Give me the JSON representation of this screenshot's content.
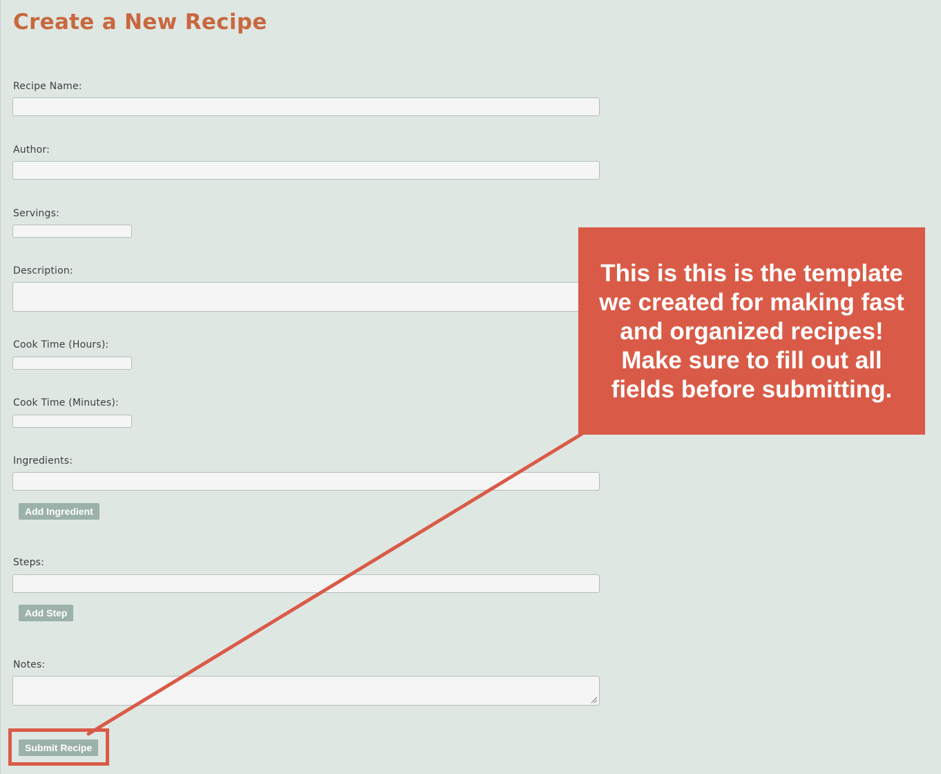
{
  "page": {
    "title": "Create a New Recipe"
  },
  "form": {
    "recipe_name": {
      "label": "Recipe Name:",
      "value": "",
      "placeholder": ""
    },
    "author": {
      "label": "Author:",
      "value": "",
      "placeholder": ""
    },
    "servings": {
      "label": "Servings:",
      "value": "",
      "placeholder": ""
    },
    "description": {
      "label": "Description:",
      "value": "",
      "placeholder": ""
    },
    "cook_time_hours": {
      "label": "Cook Time (Hours):",
      "value": "",
      "placeholder": ""
    },
    "cook_time_minutes": {
      "label": "Cook Time (Minutes):",
      "value": "",
      "placeholder": ""
    },
    "ingredients": {
      "label": "Ingredients:",
      "value": "",
      "placeholder": "",
      "add_button": "Add Ingredient"
    },
    "steps": {
      "label": "Steps:",
      "value": "",
      "placeholder": "",
      "add_button": "Add Step"
    },
    "notes": {
      "label": "Notes:",
      "value": "",
      "placeholder": ""
    },
    "submit_button": "Submit Recipe"
  },
  "annotation": {
    "lines": [
      "This is this is the template",
      "we created for making fast",
      "and organized recipes!",
      "Make sure to fill out all",
      "fields before submitting."
    ]
  },
  "colors": {
    "background": "#dfe7e3",
    "title": "#c8683f",
    "button": "#9bb1a9",
    "annotation": "#d95b47",
    "input_bg": "#f5f5f5"
  }
}
